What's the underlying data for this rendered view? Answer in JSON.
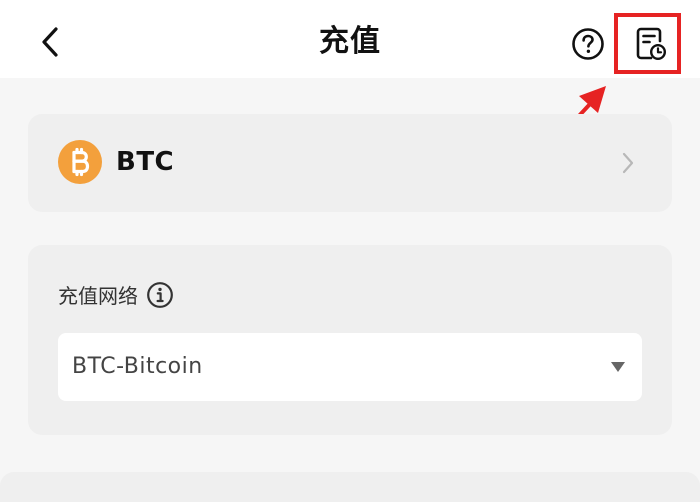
{
  "header": {
    "title": "充值",
    "back_icon": "chevron-left-icon",
    "help_icon": "question-circle-icon",
    "history_icon": "deposit-history-icon"
  },
  "coin": {
    "symbol": "BTC",
    "icon": "bitcoin-icon",
    "icon_color": "#f3a03c"
  },
  "network": {
    "label": "充值网络",
    "info_icon": "info-circle-icon",
    "selected": "BTC-Bitcoin"
  },
  "annotation": {
    "color": "#e62323"
  }
}
